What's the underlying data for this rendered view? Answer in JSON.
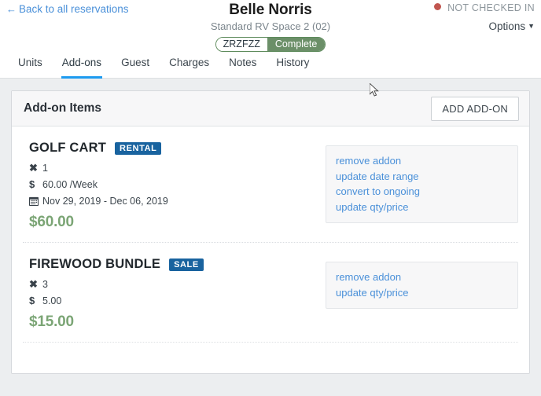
{
  "header": {
    "back_link": "Back to all reservations",
    "back_arrow_icon": "arrow-left-icon",
    "title": "Belle Norris",
    "subtitle": "Standard RV Space 2 (02)",
    "pill": {
      "code": "ZRZFZZ",
      "state": "Complete",
      "state_color": "#6b8f68"
    },
    "checkin_status": "NOT CHECKED IN",
    "checkin_dot_color": "#c1564f",
    "options_label": "Options",
    "options_caret_icon": "caret-down-icon"
  },
  "tabs": {
    "active": "Add-ons",
    "accent_color": "#1d9bf0",
    "items": [
      {
        "label": "Units"
      },
      {
        "label": "Add-ons"
      },
      {
        "label": "Guest"
      },
      {
        "label": "Charges"
      },
      {
        "label": "Notes"
      },
      {
        "label": "History"
      }
    ]
  },
  "panel": {
    "title": "Add-on Items",
    "add_button": "ADD ADD-ON"
  },
  "addons": [
    {
      "name": "GOLF CART",
      "badge": "RENTAL",
      "badge_color": "#19639f",
      "quantity_icon": "multiply-icon",
      "quantity": "1",
      "price_icon": "dollar-icon",
      "price": "60.00 /Week",
      "date_icon": "calendar-icon",
      "date_range": "Nov 29, 2019 - Dec 06, 2019",
      "total": "$60.00",
      "total_color": "#7ba575",
      "actions": [
        {
          "label": "remove addon"
        },
        {
          "label": "update date range"
        },
        {
          "label": "convert to ongoing"
        },
        {
          "label": "update qty/price"
        }
      ]
    },
    {
      "name": "FIREWOOD BUNDLE",
      "badge": "SALE",
      "badge_color": "#19639f",
      "quantity_icon": "multiply-icon",
      "quantity": "3",
      "price_icon": "dollar-icon",
      "price": "5.00",
      "date_icon": null,
      "date_range": null,
      "total": "$15.00",
      "total_color": "#7ba575",
      "actions": [
        {
          "label": "remove addon"
        },
        {
          "label": "update qty/price"
        }
      ]
    }
  ]
}
